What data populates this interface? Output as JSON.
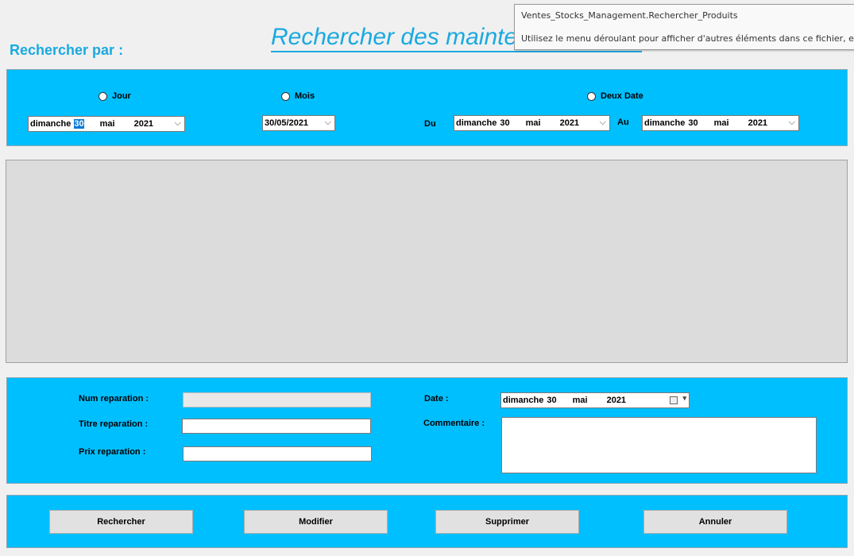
{
  "header": {
    "search_by_label": "Rechercher par :",
    "form_title": "Rechercher des  maintenances"
  },
  "tooltip": {
    "line1": "Ventes_Stocks_Management.Rechercher_Produits",
    "line2": "Utilisez le menu déroulant pour afficher d'autres éléments dans ce fichier, et y ac"
  },
  "filter": {
    "radio_jour": "Jour",
    "radio_mois": "Mois",
    "radio_deux_dates": "Deux Date",
    "jour_picker": {
      "day_name": "dimanche",
      "day": "30",
      "month": "mai",
      "year": "2021"
    },
    "mois_picker": "30/05/2021",
    "du_label": "Du",
    "au_label": "Au",
    "du_picker": {
      "day_name": "dimanche",
      "day": "30",
      "month": "mai",
      "year": "2021"
    },
    "au_picker": {
      "day_name": "dimanche",
      "day": "30",
      "month": "mai",
      "year": "2021"
    },
    "chevron": "⌵"
  },
  "details": {
    "num_label": "Num reparation :",
    "titre_label": "Titre reparation :",
    "prix_label": "Prix reparation :",
    "date_label": "Date :",
    "commentaire_label": "Commentaire :",
    "date_picker": {
      "day_name": "dimanche",
      "day": "30",
      "month": "mai",
      "year": "2021"
    },
    "num_value": "",
    "titre_value": "",
    "prix_value": "",
    "commentaire_value": ""
  },
  "actions": {
    "rechercher": "Rechercher",
    "modifier": "Modifier",
    "supprimer": "Supprimer",
    "annuler": "Annuler"
  },
  "colors": {
    "panel_bg": "#00bfff",
    "title_color": "#1aa9e0",
    "window_bg": "#f0f0f0"
  }
}
